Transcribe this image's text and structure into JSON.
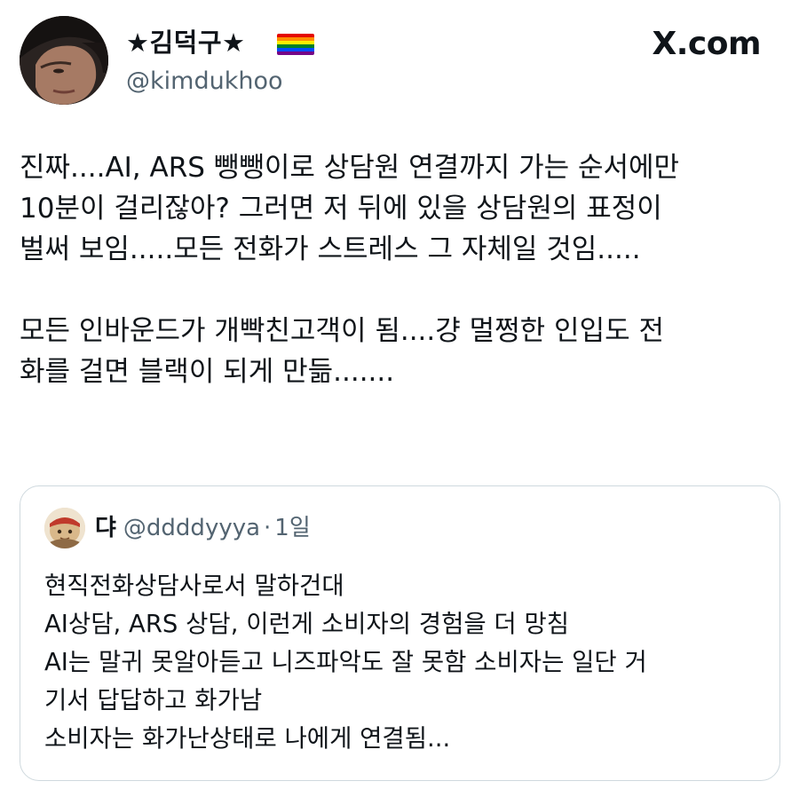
{
  "author": {
    "display_name": "★김덕구★",
    "flag_icon": "rainbow-flag-icon",
    "flag_colors": [
      "#e40303",
      "#ff8c00",
      "#ffed00",
      "#008026",
      "#004dff",
      "#750787"
    ],
    "handle": "@kimdukhoo"
  },
  "site": {
    "logo_text": "X.com"
  },
  "tweet": {
    "lines": [
      "진짜....AI, ARS 뺑뺑이로 상담원 연결까지 가는 순서에만",
      "10분이 걸리잖아? 그러면 저 뒤에 있을 상담원의 표정이",
      "벌써 보임.....모든 전화가 스트레스 그 자체일 것임.....",
      "",
      "모든 인바운드가 개빡친고객이 됨....걍 멀쩡한 인입도 전",
      "화를 걸면 블랙이 되게 만듦......."
    ]
  },
  "quoted_tweet": {
    "display_name": "댜",
    "handle": "@ddddyyya",
    "separator": "·",
    "time": "1일",
    "lines": [
      "현직전화상담사로서 말하건대",
      "AI상담, ARS 상담, 이런게 소비자의 경험을 더 망침",
      "AI는 말귀 못알아듣고 니즈파악도 잘 못함 소비자는 일단 거",
      "기서 답답하고 화가남",
      "소비자는 화가난상태로 나에게 연결됨..."
    ]
  }
}
